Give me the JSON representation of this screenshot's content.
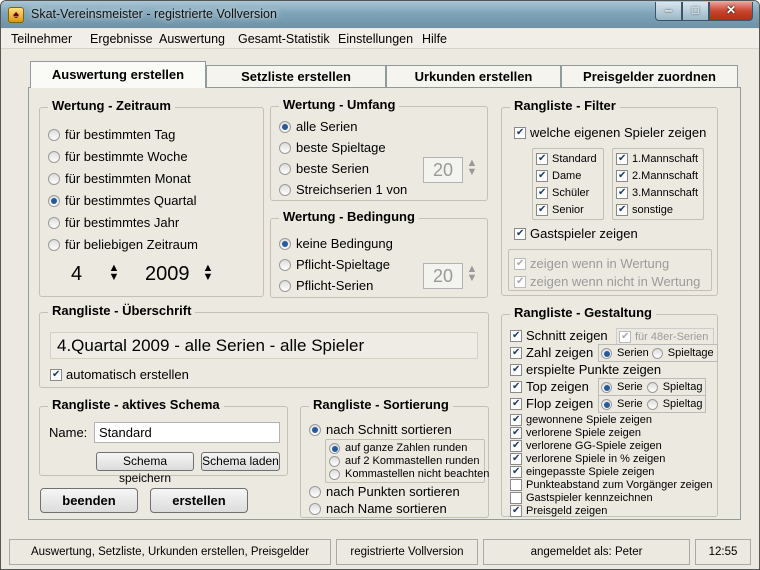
{
  "window": {
    "title": "Skat-Vereinsmeister - registrierte Vollversion",
    "icon": "spade-icon"
  },
  "menu": [
    "Teilnehmer",
    "Ergebnisse",
    "Auswertung",
    "Gesamt-Statistik",
    "Einstellungen",
    "Hilfe"
  ],
  "tabs": [
    "Auswertung erstellen",
    "Setzliste erstellen",
    "Urkunden erstellen",
    "Preisgelder zuordnen"
  ],
  "zeitraum": {
    "title": "Wertung - Zeitraum",
    "options": [
      "für bestimmten Tag",
      "für bestimmte Woche",
      "für bestimmten Monat",
      "für bestimmtes Quartal",
      "für bestimmtes Jahr",
      "für beliebigen Zeitraum"
    ],
    "quarter": "4",
    "year": "2009"
  },
  "umfang": {
    "title": "Wertung - Umfang",
    "options": [
      "alle Serien",
      "beste Spieltage",
      "beste Serien",
      "Streichserien 1 von"
    ],
    "value": "20"
  },
  "bedingung": {
    "title": "Wertung - Bedingung",
    "options": [
      "keine Bedingung",
      "Pflicht-Spieltage",
      "Pflicht-Serien"
    ],
    "value": "20"
  },
  "filter": {
    "title": "Rangliste - Filter",
    "eigene": "welche eigenen Spieler zeigen",
    "left": [
      "Standard",
      "Dame",
      "Schüler",
      "Senior"
    ],
    "right": [
      "1.Mannschaft",
      "2.Mannschaft",
      "3.Mannschaft",
      "sonstige"
    ],
    "gast": "Gastspieler zeigen",
    "in_wertung": "zeigen wenn in Wertung",
    "nicht_wertung": "zeigen wenn nicht in Wertung"
  },
  "ueberschrift": {
    "title": "Rangliste - Überschrift",
    "text": "4.Quartal 2009 - alle Serien - alle Spieler",
    "auto": "automatisch erstellen"
  },
  "schema": {
    "title": "Rangliste - aktives Schema",
    "name_label": "Name:",
    "name": "Standard",
    "save": "Schema speichern",
    "load": "Schema laden"
  },
  "sortierung": {
    "title": "Rangliste - Sortierung",
    "schnitt": "nach Schnitt sortieren",
    "sub": [
      "auf ganze Zahlen runden",
      "auf 2 Kommastellen runden",
      "Kommastellen nicht beachten"
    ],
    "punkte": "nach Punkten sortieren",
    "name": "nach Name sortieren"
  },
  "gestaltung": {
    "title": "Rangliste - Gestaltung",
    "schnitt": "Schnitt zeigen",
    "fuer48": "für 48er-Serien",
    "zahl": "Zahl zeigen",
    "serien": "Serien",
    "spieltage": "Spieltage",
    "punkte": "erspielte Punkte zeigen",
    "top": "Top zeigen",
    "flop": "Flop zeigen",
    "serie": "Serie",
    "spieltag": "Spieltag",
    "list": [
      "gewonnene Spiele zeigen",
      "verlorene Spiele zeigen",
      "verlorene GG-Spiele zeigen",
      "verlorene Spiele in % zeigen",
      "eingepasste Spiele zeigen",
      "Punkteabstand zum Vorgänger zeigen",
      "Gastspieler kennzeichnen",
      "Preisgeld zeigen"
    ]
  },
  "buttons": {
    "beenden": "beenden",
    "erstellen": "erstellen"
  },
  "status": [
    "Auswertung, Setzliste, Urkunden erstellen, Preisgelder zuordnen",
    "registrierte Vollversion",
    "angemeldet als: Peter",
    "12:55"
  ]
}
